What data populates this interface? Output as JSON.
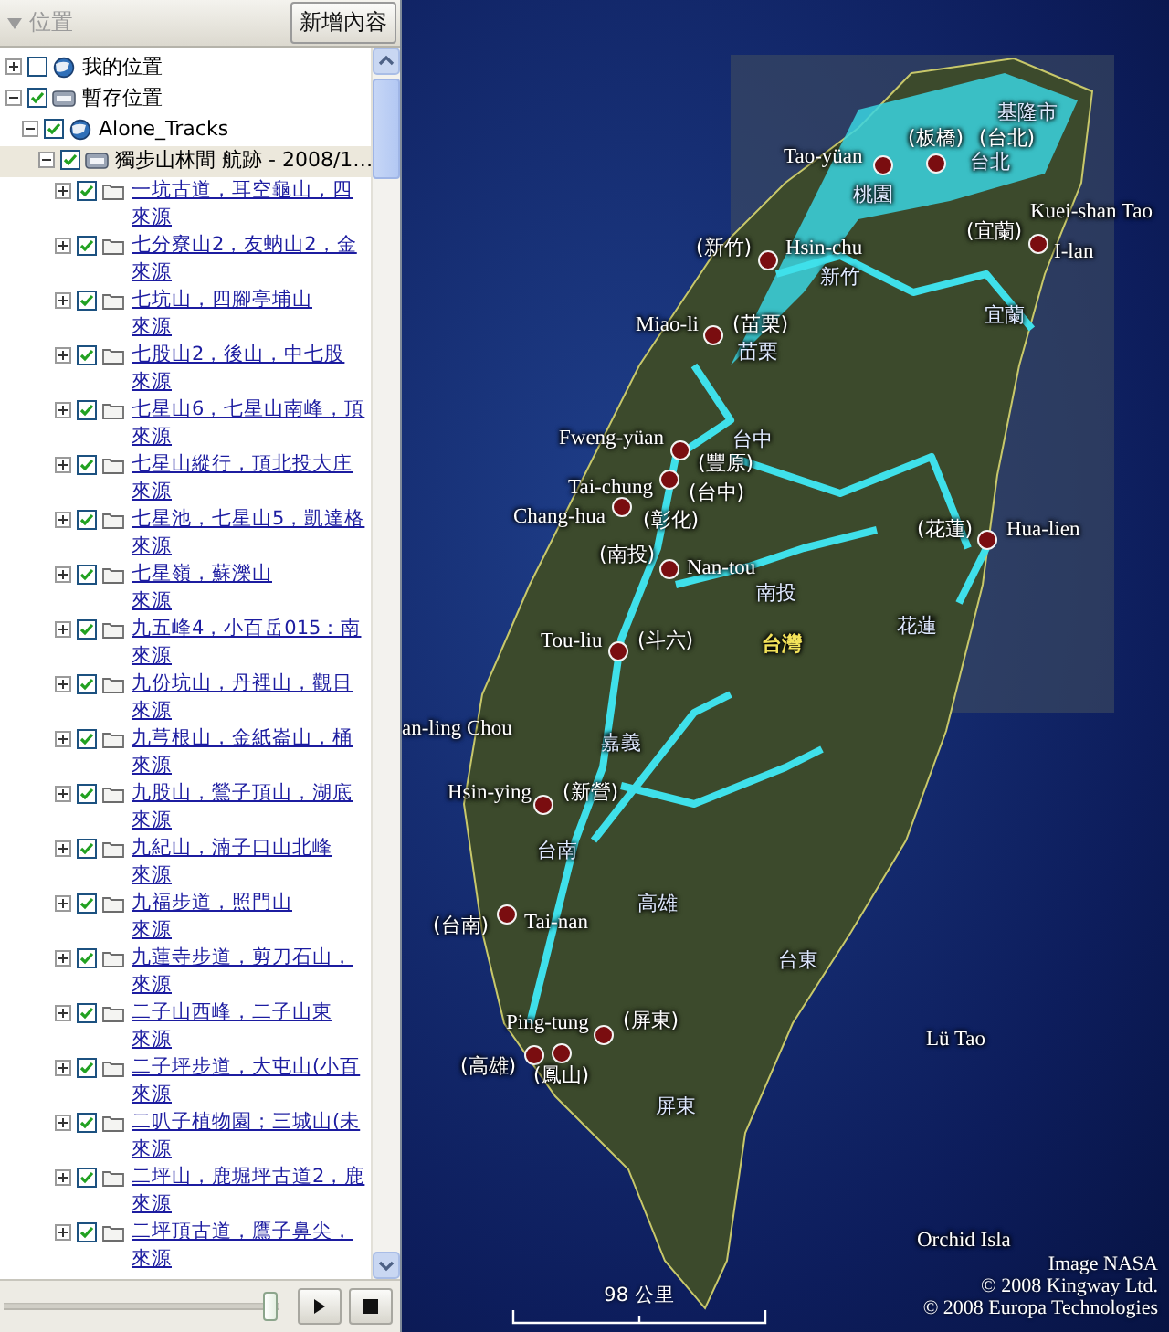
{
  "panel": {
    "title": "位置",
    "expanded": true,
    "add_button": "新增內容"
  },
  "tree": [
    {
      "label": "我的位置",
      "checked": false,
      "expanded": false,
      "selected": false
    },
    {
      "label": "暫存位置",
      "checked": true,
      "expanded": true,
      "selected": false,
      "children": [
        {
          "label": "Alone_Tracks",
          "checked": true,
          "expanded": true,
          "selected": false,
          "children": [
            {
              "label": "獨步山林間 航跡 - 2008/1…",
              "checked": true,
              "expanded": true,
              "selected": true,
              "children": [
                {
                  "label": "一坑古道，耳空龜山，四",
                  "sub": "來源",
                  "checked": true,
                  "expanded": false,
                  "selected": false
                },
                {
                  "label": "七分寮山2，友蚋山2，金",
                  "sub": "來源",
                  "checked": true,
                  "expanded": false,
                  "selected": false
                },
                {
                  "label": "七坑山，四腳亭埔山",
                  "sub": "來源",
                  "checked": true,
                  "expanded": false,
                  "selected": false
                },
                {
                  "label": "七股山2，後山，中七股",
                  "sub": "來源",
                  "checked": true,
                  "expanded": false,
                  "selected": false
                },
                {
                  "label": "七星山6，七星山南峰，頂",
                  "sub": "來源",
                  "checked": true,
                  "expanded": false,
                  "selected": false
                },
                {
                  "label": "七星山縱行，頂北投大庄",
                  "sub": "來源",
                  "checked": true,
                  "expanded": false,
                  "selected": false
                },
                {
                  "label": "七星池，七星山5，凱達格",
                  "sub": "來源",
                  "checked": true,
                  "expanded": false,
                  "selected": false
                },
                {
                  "label": "七星嶺，蘇濼山",
                  "sub": "來源",
                  "checked": true,
                  "expanded": false,
                  "selected": false
                },
                {
                  "label": "九五峰4，小百岳015：南",
                  "sub": "來源",
                  "checked": true,
                  "expanded": false,
                  "selected": false
                },
                {
                  "label": "九份坑山，丹裡山，觀日",
                  "sub": "來源",
                  "checked": true,
                  "expanded": false,
                  "selected": false
                },
                {
                  "label": "九芎根山，金紙崙山，桶",
                  "sub": "來源",
                  "checked": true,
                  "expanded": false,
                  "selected": false
                },
                {
                  "label": "九股山，鶯子頂山，湖底",
                  "sub": "來源",
                  "checked": true,
                  "expanded": false,
                  "selected": false
                },
                {
                  "label": "九紀山，湳子口山北峰",
                  "sub": "來源",
                  "checked": true,
                  "expanded": false,
                  "selected": false
                },
                {
                  "label": "九福步道，照門山",
                  "sub": "來源",
                  "checked": true,
                  "expanded": false,
                  "selected": false
                },
                {
                  "label": "九蓮寺步道，剪刀石山，",
                  "sub": "來源",
                  "checked": true,
                  "expanded": false,
                  "selected": false
                },
                {
                  "label": "二子山西峰，二子山東",
                  "sub": "來源",
                  "checked": true,
                  "expanded": false,
                  "selected": false
                },
                {
                  "label": "二子坪步道，大屯山(小百",
                  "sub": "來源",
                  "checked": true,
                  "expanded": false,
                  "selected": false
                },
                {
                  "label": "二叭子植物園；三城山(未",
                  "sub": "來源",
                  "checked": true,
                  "expanded": false,
                  "selected": false
                },
                {
                  "label": "二坪山，鹿堀坪古道2，鹿",
                  "sub": "來源",
                  "checked": true,
                  "expanded": false,
                  "selected": false
                },
                {
                  "label": "二坪頂古道，鷹子鼻尖，",
                  "sub": "來源",
                  "checked": true,
                  "expanded": false,
                  "selected": false
                }
              ]
            }
          ]
        }
      ]
    }
  ],
  "time_slider": {
    "level": 0.97
  },
  "map": {
    "labels": [
      {
        "text": "基隆市",
        "kind": "region"
      },
      {
        "text": "(板橋)",
        "kind": "city"
      },
      {
        "text": "(台北)",
        "kind": "city"
      },
      {
        "text": "Tao-yüan",
        "kind": "romanized"
      },
      {
        "text": "台北",
        "kind": "region"
      },
      {
        "text": "桃園",
        "kind": "region"
      },
      {
        "text": "Kuei-shan Tao",
        "kind": "romanized"
      },
      {
        "text": "(宜蘭)",
        "kind": "city"
      },
      {
        "text": "(新竹)",
        "kind": "city"
      },
      {
        "text": "Hsin-chu",
        "kind": "romanized"
      },
      {
        "text": "I-lan",
        "kind": "romanized"
      },
      {
        "text": "新竹",
        "kind": "region"
      },
      {
        "text": "宜蘭",
        "kind": "region"
      },
      {
        "text": "Miao-li",
        "kind": "romanized"
      },
      {
        "text": "(苗栗)",
        "kind": "city"
      },
      {
        "text": "苗栗",
        "kind": "region"
      },
      {
        "text": "Fweng-yüan",
        "kind": "romanized"
      },
      {
        "text": "台中",
        "kind": "region"
      },
      {
        "text": "(豐原)",
        "kind": "city"
      },
      {
        "text": "Tai-chung",
        "kind": "romanized"
      },
      {
        "text": "(台中)",
        "kind": "city"
      },
      {
        "text": "Chang-hua",
        "kind": "romanized"
      },
      {
        "text": "(彰化)",
        "kind": "city"
      },
      {
        "text": "(花蓮)",
        "kind": "city"
      },
      {
        "text": "Hua-lien",
        "kind": "romanized"
      },
      {
        "text": "(南投)",
        "kind": "city"
      },
      {
        "text": "Nan-tou",
        "kind": "romanized"
      },
      {
        "text": "南投",
        "kind": "region"
      },
      {
        "text": "花蓮",
        "kind": "region"
      },
      {
        "text": "Tou-liu",
        "kind": "romanized"
      },
      {
        "text": "(斗六)",
        "kind": "city"
      },
      {
        "text": "台灣",
        "kind": "country"
      },
      {
        "text": "an-ling Chou",
        "kind": "romanized"
      },
      {
        "text": "嘉義",
        "kind": "region"
      },
      {
        "text": "Hsin-ying",
        "kind": "romanized"
      },
      {
        "text": "(新營)",
        "kind": "city"
      },
      {
        "text": "台南",
        "kind": "region"
      },
      {
        "text": "高雄",
        "kind": "region"
      },
      {
        "text": "(台南)",
        "kind": "city"
      },
      {
        "text": "Tai-nan",
        "kind": "romanized"
      },
      {
        "text": "台東",
        "kind": "region"
      },
      {
        "text": "Ping-tung",
        "kind": "romanized"
      },
      {
        "text": "(屏東)",
        "kind": "city"
      },
      {
        "text": "Lü Tao",
        "kind": "romanized"
      },
      {
        "text": "(高雄)",
        "kind": "city"
      },
      {
        "text": "(鳳山)",
        "kind": "city"
      },
      {
        "text": "屏東",
        "kind": "region"
      },
      {
        "text": "Orchid Isla",
        "kind": "romanized"
      }
    ],
    "scale": "98 公里",
    "credits": [
      "Image NASA",
      "© 2008 Kingway Ltd.",
      "© 2008 Europa Technologies"
    ]
  }
}
